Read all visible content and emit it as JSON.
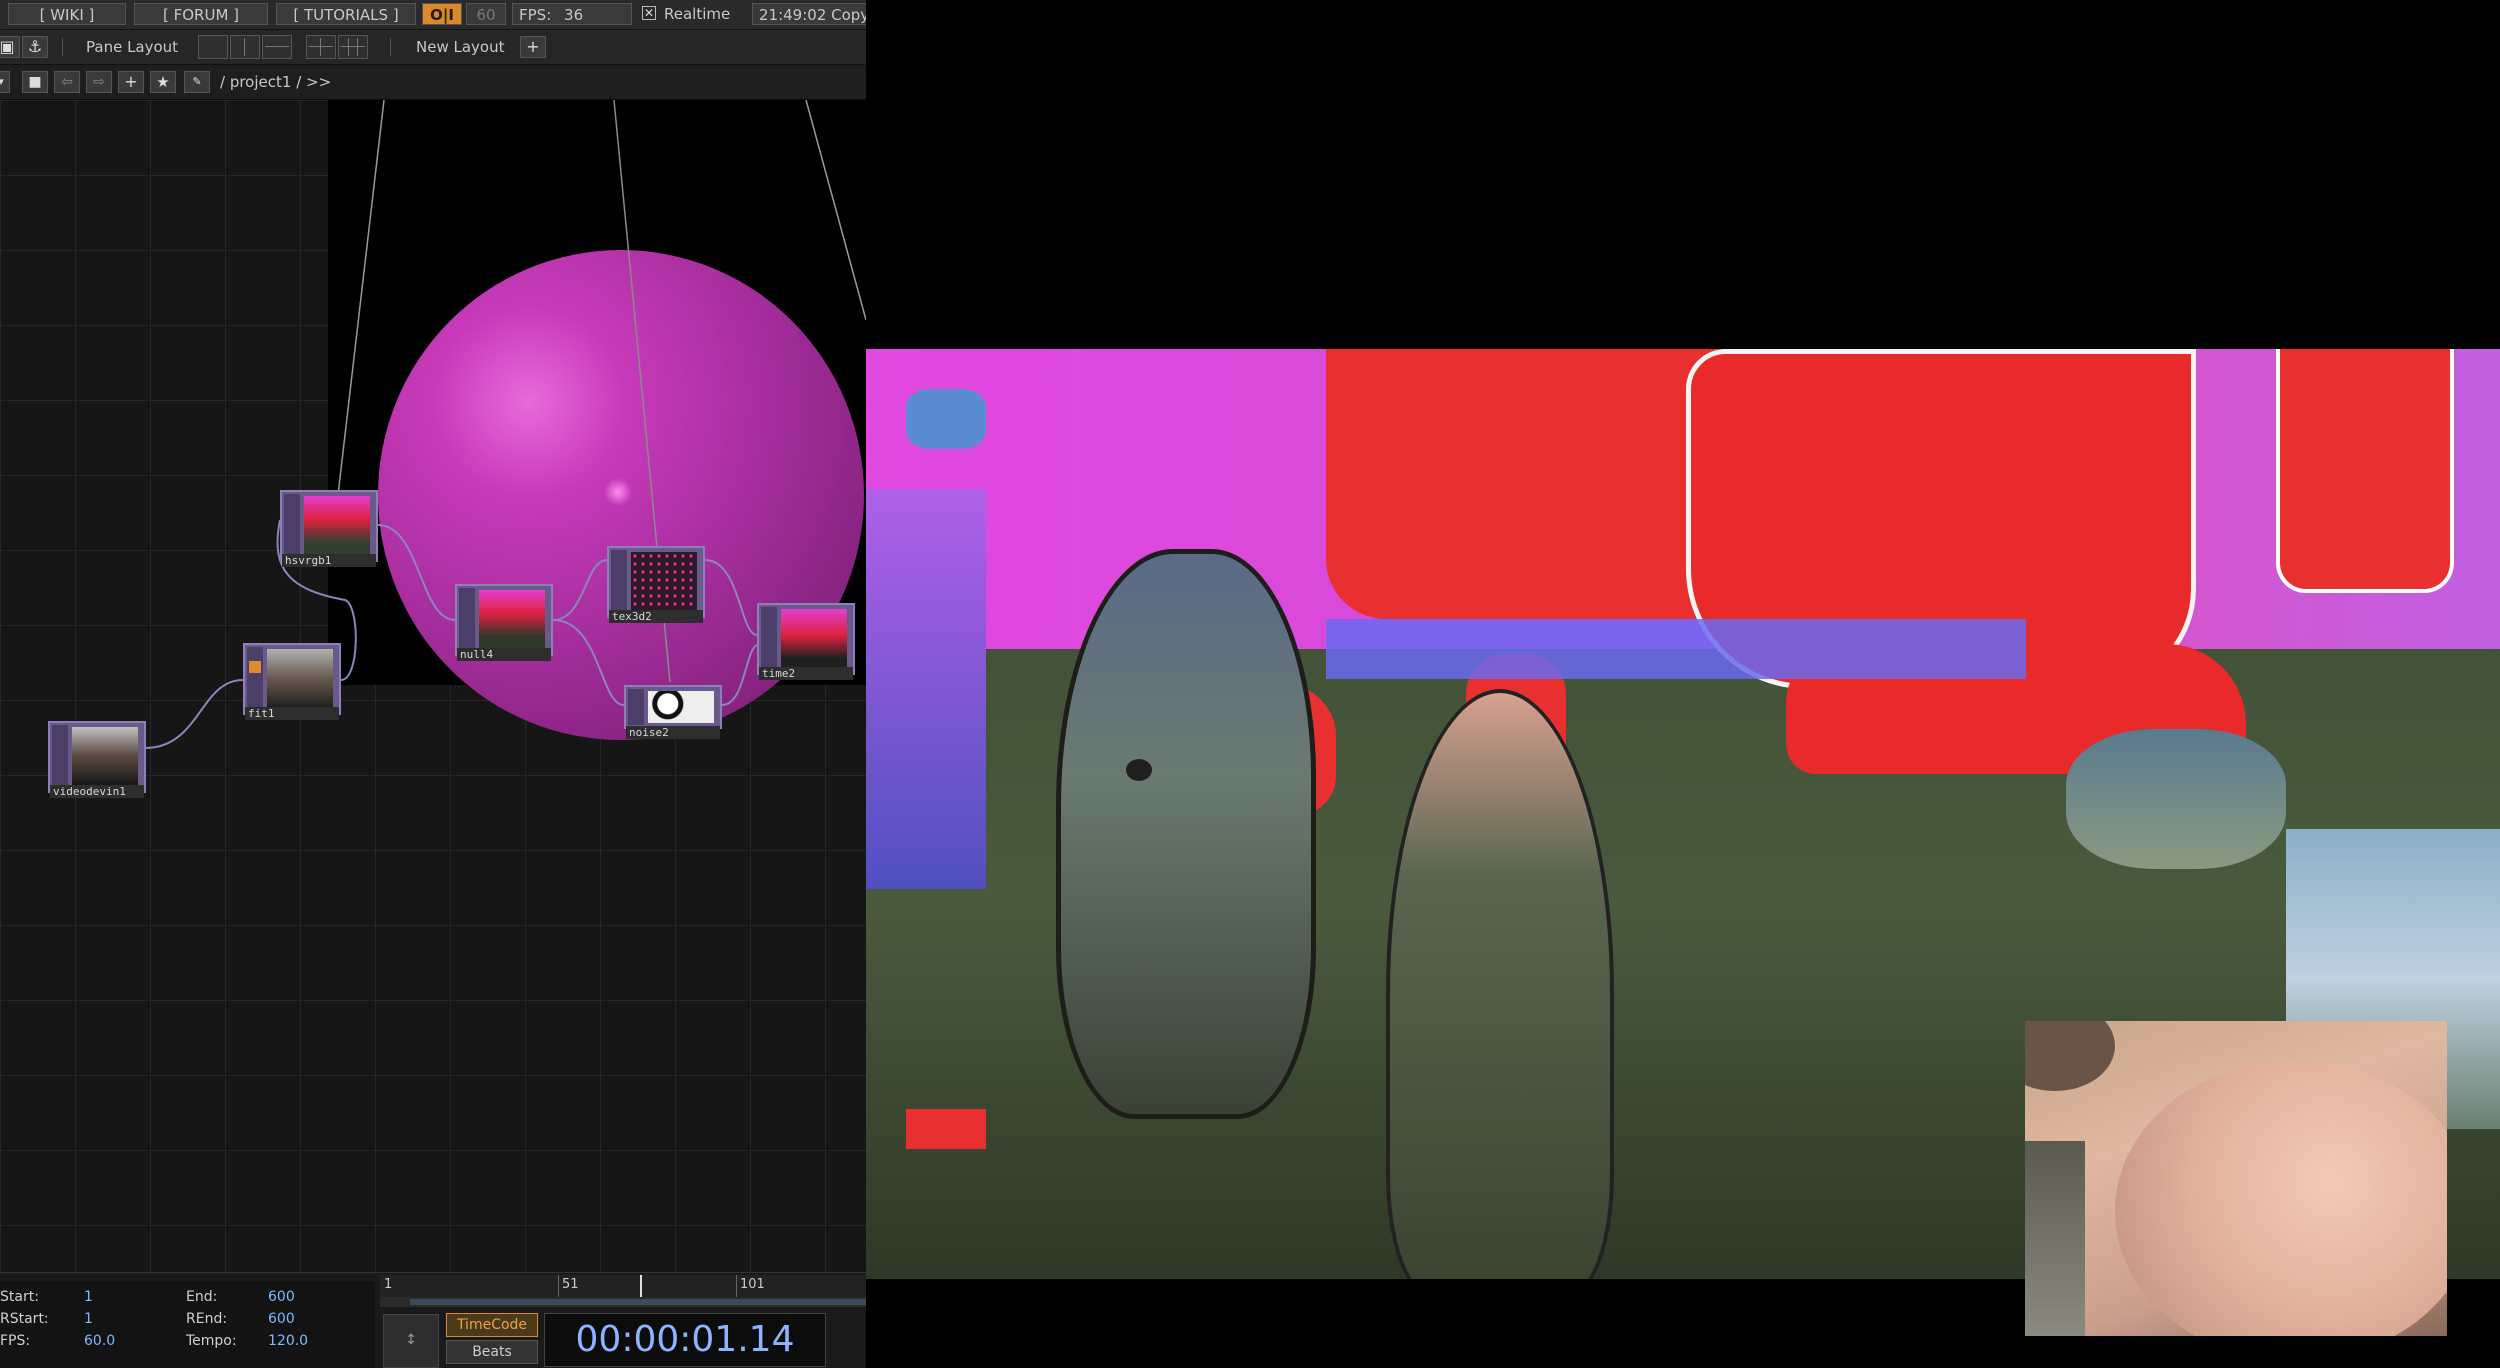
{
  "topbar": {
    "wiki": "[ WIKI ]",
    "forum": "[ FORUM ]",
    "tutorials": "[ TUTORIALS ]",
    "oi": "O|I",
    "fps_cap": "60",
    "fps_label": "FPS:",
    "fps_value": "36",
    "realtime": "Realtime",
    "clock": "21:49:02 Copy"
  },
  "panebar": {
    "pane_layout": "Pane Layout",
    "new_layout": "New Layout",
    "plus": "+"
  },
  "pathbar": {
    "path": "/ project1 / >>"
  },
  "network": {
    "nodes": [
      {
        "name": "hsvrgb1"
      },
      {
        "name": "fit1"
      },
      {
        "name": "videodevin1"
      },
      {
        "name": "null4"
      },
      {
        "name": "tex3d2"
      },
      {
        "name": "noise2"
      },
      {
        "name": "time2"
      }
    ]
  },
  "timeline": {
    "start_label": "Start:",
    "start_value": "1",
    "end_label": "End:",
    "end_value": "600",
    "rstart_label": "RStart:",
    "rstart_value": "1",
    "rend_label": "REnd:",
    "rend_value": "600",
    "fps_label": "FPS:",
    "fps_value": "60.0",
    "tempo_label": "Tempo:",
    "tempo_value": "120.0",
    "ruler_ticks": [
      "1",
      "51",
      "101"
    ],
    "timecode_button": "TimeCode",
    "beats_button": "Beats",
    "timecode": "00:00:01.14"
  },
  "colors": {
    "accent": "#d98a2a",
    "node_purple": "#6a5a8c",
    "sphere_magenta": "#c83aba",
    "timecode_blue": "#8fb4ff"
  }
}
